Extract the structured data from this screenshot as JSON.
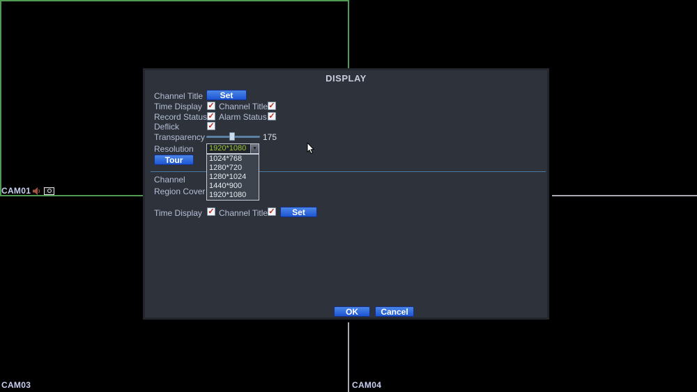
{
  "colors": {
    "selected_border_green": "#4f9b52",
    "grid_line_gray": "#a9aab2",
    "button_blue": "#1d55d2",
    "resolution_text_green": "#9cc838",
    "dialog_bg": "#2e323b",
    "divider_blue": "#4a7ba6",
    "check_red": "#c0281e"
  },
  "icons": {
    "check": "✓",
    "dropdown_arrow": "▼"
  },
  "background": {
    "cam1": {
      "label": "CAM01"
    },
    "cam3": {
      "label": "CAM03"
    },
    "cam4": {
      "label": "CAM04"
    }
  },
  "dialog": {
    "title": "DISPLAY",
    "channel_title_row": {
      "label": "Channel Title",
      "button": "Set"
    },
    "time_display_row": {
      "label": "Time Display",
      "checked": true,
      "second_label": "Channel Title",
      "second_checked": true
    },
    "record_status_row": {
      "label": "Record Status",
      "checked": true,
      "second_label": "Alarm Status",
      "second_checked": true
    },
    "deflick_row": {
      "label": "Deflick",
      "checked": true
    },
    "transparency": {
      "label": "Transparency",
      "value": "175"
    },
    "resolution": {
      "label": "Resolution",
      "selected": "1920*1080",
      "options": [
        "1024*768",
        "1280*720",
        "1280*1024",
        "1440*900",
        "1920*1080"
      ]
    },
    "tour_button": "Tour",
    "channel_label": "Channel",
    "region_cover_label": "Region Cover",
    "bottom_row": {
      "label": "Time Display",
      "checked": true,
      "second_label": "Channel Title",
      "second_checked": true,
      "button": "Set"
    },
    "ok_button": "OK",
    "cancel_button": "Cancel"
  }
}
